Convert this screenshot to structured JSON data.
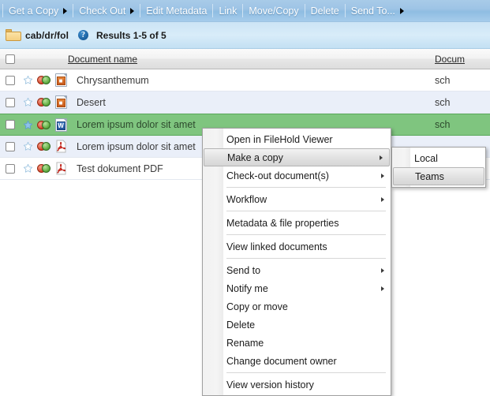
{
  "toolbar": {
    "items": [
      {
        "label": "Get a Copy",
        "has_arrow": true,
        "name": "toolbar-get-a-copy"
      },
      {
        "label": "Check Out",
        "has_arrow": true,
        "name": "toolbar-check-out"
      },
      {
        "label": "Edit Metadata",
        "has_arrow": false,
        "name": "toolbar-edit-metadata"
      },
      {
        "label": "Link",
        "has_arrow": false,
        "name": "toolbar-link"
      },
      {
        "label": "Move/Copy",
        "has_arrow": false,
        "name": "toolbar-move-copy"
      },
      {
        "label": "Delete",
        "has_arrow": false,
        "name": "toolbar-delete"
      },
      {
        "label": "Send To...",
        "has_arrow": true,
        "name": "toolbar-send-to"
      }
    ]
  },
  "breadcrumb": {
    "folder_icon": "folder-icon",
    "path": "cab/dr/fol",
    "help_icon": "help-icon",
    "help_glyph": "?",
    "results": "Results 1-5 of 5"
  },
  "grid": {
    "headers": {
      "select_all": "",
      "document_name": "Document name",
      "document_number": "Docum"
    },
    "rows": [
      {
        "name": "Chrysanthemum",
        "doc_num": "sch",
        "file_type": "image",
        "starred": false,
        "selected": false
      },
      {
        "name": "Desert",
        "doc_num": "sch",
        "file_type": "image",
        "starred": false,
        "selected": false
      },
      {
        "name": "Lorem ipsum dolor sit amet",
        "doc_num": "sch",
        "file_type": "word",
        "starred": true,
        "selected": true
      },
      {
        "name": "Lorem ipsum dolor sit amet",
        "doc_num": "",
        "file_type": "pdf",
        "starred": false,
        "selected": false
      },
      {
        "name": "Test dokument PDF",
        "doc_num": "",
        "file_type": "pdf",
        "starred": false,
        "selected": false
      }
    ]
  },
  "context_menu": {
    "items": [
      {
        "label": "Open in FileHold Viewer",
        "submenu": false,
        "hover": false,
        "sep_after": false,
        "name": "menu-open-in-filehold-viewer"
      },
      {
        "label": "Make a copy",
        "submenu": true,
        "hover": true,
        "sep_after": false,
        "name": "menu-make-a-copy"
      },
      {
        "label": "Check-out document(s)",
        "submenu": true,
        "hover": false,
        "sep_after": true,
        "name": "menu-check-out-documents"
      },
      {
        "label": "Workflow",
        "submenu": true,
        "hover": false,
        "sep_after": true,
        "name": "menu-workflow"
      },
      {
        "label": "Metadata & file properties",
        "submenu": false,
        "hover": false,
        "sep_after": true,
        "name": "menu-metadata-file-properties"
      },
      {
        "label": "View linked documents",
        "submenu": false,
        "hover": false,
        "sep_after": true,
        "name": "menu-view-linked-documents"
      },
      {
        "label": "Send to",
        "submenu": true,
        "hover": false,
        "sep_after": false,
        "name": "menu-send-to"
      },
      {
        "label": "Notify me",
        "submenu": true,
        "hover": false,
        "sep_after": false,
        "name": "menu-notify-me"
      },
      {
        "label": "Copy or move",
        "submenu": false,
        "hover": false,
        "sep_after": false,
        "name": "menu-copy-or-move"
      },
      {
        "label": "Delete",
        "submenu": false,
        "hover": false,
        "sep_after": false,
        "name": "menu-delete"
      },
      {
        "label": "Rename",
        "submenu": false,
        "hover": false,
        "sep_after": false,
        "name": "menu-rename"
      },
      {
        "label": "Change document owner",
        "submenu": false,
        "hover": false,
        "sep_after": true,
        "name": "menu-change-document-owner"
      },
      {
        "label": "View version history",
        "submenu": false,
        "hover": false,
        "sep_after": false,
        "name": "menu-view-version-history"
      }
    ]
  },
  "submenu": {
    "items": [
      {
        "label": "Local",
        "hover": false,
        "name": "submenu-local"
      },
      {
        "label": "Teams",
        "hover": true,
        "name": "submenu-teams"
      }
    ]
  },
  "colors": {
    "toolbar_blue": "#9ec4e6",
    "crumb_blue": "#cce4f5",
    "row_alt": "#eaeff9",
    "row_selected_green": "#7fc57f",
    "menu_bg": "#ffffff"
  }
}
